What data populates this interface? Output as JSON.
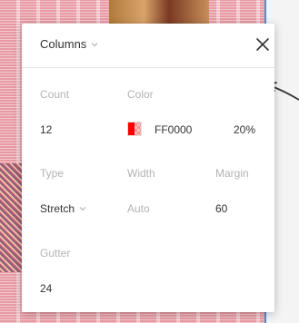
{
  "panel": {
    "title": "Columns",
    "close_icon": "close-icon"
  },
  "grid": {
    "count_label": "Count",
    "count_value": "12",
    "color_label": "Color",
    "color_hex": "FF0000",
    "color_opacity": "20%",
    "type_label": "Type",
    "type_value": "Stretch",
    "width_label": "Width",
    "width_value": "Auto",
    "margin_label": "Margin",
    "margin_value": "60",
    "gutter_label": "Gutter",
    "gutter_value": "24"
  },
  "colors": {
    "swatch": "#FF0000",
    "canvas_border": "#4A8FE0",
    "label": "#B3B3B3",
    "text": "#333333"
  }
}
